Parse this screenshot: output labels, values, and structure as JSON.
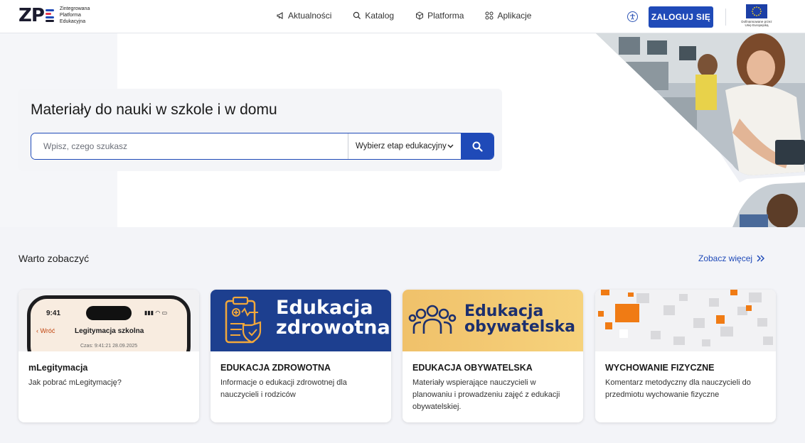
{
  "header": {
    "logo_mark": "ZPE",
    "logo_text": [
      "Zintegrowana",
      "Platforma",
      "Edukacyjna"
    ],
    "nav": [
      {
        "label": "Aktualności",
        "icon": "megaphone-icon"
      },
      {
        "label": "Katalog",
        "icon": "search-icon"
      },
      {
        "label": "Platforma",
        "icon": "cube-icon"
      },
      {
        "label": "Aplikacje",
        "icon": "grid-icon"
      }
    ],
    "login_label": "ZALOGUJ SIĘ",
    "eu_text": [
      "Dofinansowane przez",
      "Unię Europejską"
    ]
  },
  "hero": {
    "title": "Materiały do nauki w szkole i w domu",
    "search_placeholder": "Wpisz, czego szukasz",
    "select_value": "Wybierz etap edukacyjny"
  },
  "section": {
    "title": "Warto zobaczyć",
    "see_more": "Zobacz więcej"
  },
  "cards": [
    {
      "title": "mLegitymacja",
      "desc": "Jak pobrać mLegitymację?",
      "phone_time": "9:41",
      "phone_back": "Wróć",
      "phone_title": "Legitymacja szkolna",
      "phone_stamp": "Czas: 9:41:21 28.09.2025"
    },
    {
      "title": "EDUKACJA ZDROWOTNA",
      "desc": "Informacje o edukacji zdrowotnej dla nauczycieli i rodziców",
      "banner_line1": "Edukacja",
      "banner_line2": "zdrowotna"
    },
    {
      "title": "EDUKACJA OBYWATELSKA",
      "desc": "Materiały wspierające nauczycieli w planowaniu i prowadzeniu zajęć z edukacji obywatelskiej.",
      "banner_line1": "Edukacja",
      "banner_line2": "obywatelska"
    },
    {
      "title": "WYCHOWANIE FIZYCZNE",
      "desc": "Komentarz metodyczny dla nauczycieli do przedmiotu wychowanie fizyczne"
    }
  ],
  "colors": {
    "primary": "#1f4ab8",
    "health_banner": "#1d3f8f",
    "civic_banner": "#f2c45a",
    "pe_accent": "#f07b14"
  }
}
